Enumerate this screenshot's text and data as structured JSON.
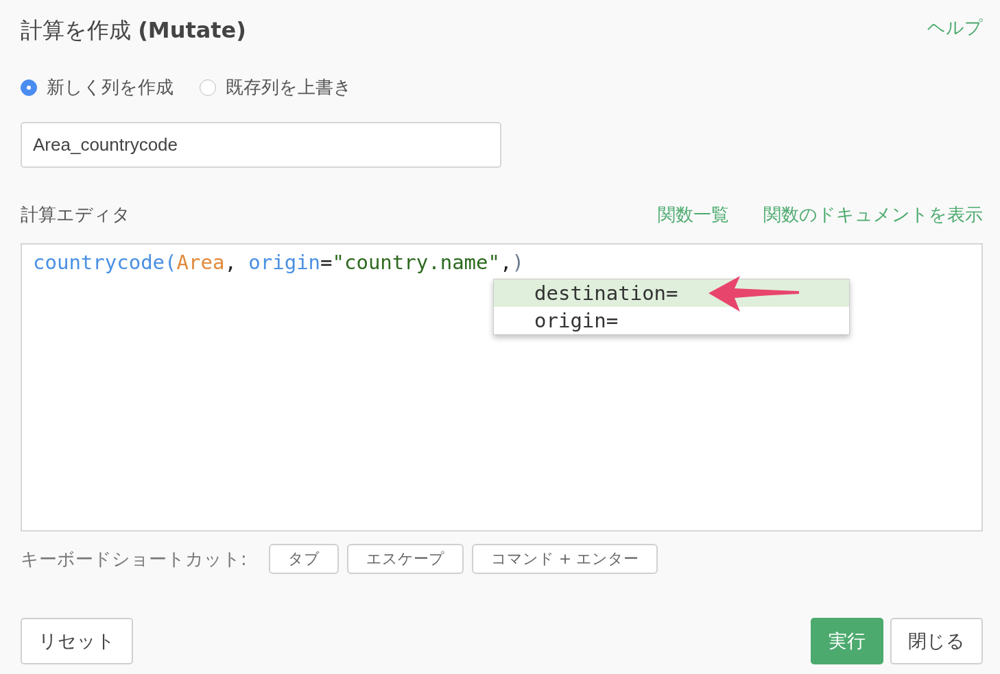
{
  "title": "計算を作成",
  "title_suffix": "(Mutate)",
  "help_link": "ヘルプ",
  "mode_options": [
    {
      "label": "新しく列を作成",
      "selected": true
    },
    {
      "label": "既存列を上書き",
      "selected": false
    }
  ],
  "column_name": {
    "value": "Area_countrycode"
  },
  "editor": {
    "label": "計算エディタ",
    "links": [
      "関数一覧",
      "関数のドキュメントを表示"
    ],
    "code": [
      {
        "kind": "function",
        "text": "countrycode"
      },
      {
        "kind": "bracket",
        "text": "("
      },
      {
        "kind": "variable",
        "text": "Area"
      },
      {
        "kind": "plain",
        "text": ", "
      },
      {
        "kind": "param",
        "text": "origin"
      },
      {
        "kind": "plain",
        "text": "="
      },
      {
        "kind": "string",
        "text": "\"country.name\""
      },
      {
        "kind": "plain",
        "text": ","
      },
      {
        "kind": "closing",
        "text": ")"
      }
    ],
    "suggestions": [
      {
        "text": "destination=",
        "selected": true
      },
      {
        "text": "origin=",
        "selected": false
      }
    ]
  },
  "shortcuts": {
    "label": "キーボードショートカット:",
    "keys": [
      "タブ",
      "エスケープ",
      "コマンド + エンター"
    ]
  },
  "buttons": {
    "reset": "リセット",
    "run": "実行",
    "close": "閉じる"
  }
}
